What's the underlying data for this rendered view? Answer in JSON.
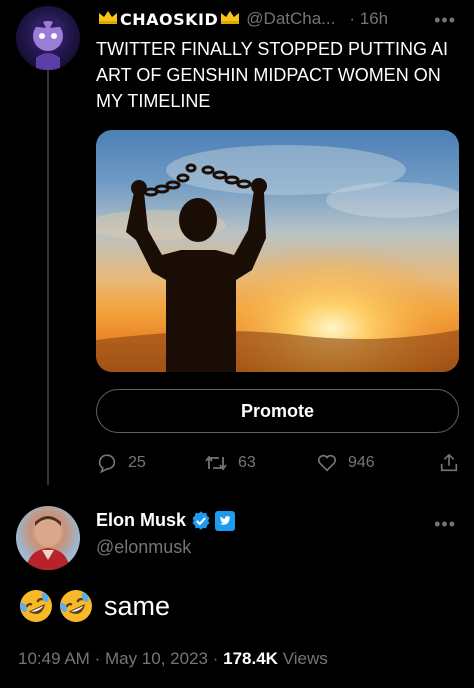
{
  "original_tweet": {
    "display_name": "CHAOSKID",
    "handle": "@DatCha...",
    "separator": "·",
    "time": "16h",
    "more": "•••",
    "text": "TWITTER FINALLY STOPPED PUTTING AI ART OF GENSHIN MIDPACT WOMEN ON MY TIMELINE",
    "promote_label": "Promote",
    "actions": {
      "replies": "25",
      "retweets": "63",
      "likes": "946"
    }
  },
  "reply_tweet": {
    "display_name": "Elon Musk",
    "handle": "@elonmusk",
    "more": "•••",
    "text": "same",
    "time": "10:49 AM",
    "date": "May 10, 2023",
    "separator": "·",
    "views_count": "178.4K",
    "views_label": "Views"
  },
  "colors": {
    "background": "#000000",
    "text_primary": "#e7e9ea",
    "text_secondary": "#71767b",
    "verified_blue": "#1d9bf0",
    "crown_gold": "#f5c518"
  },
  "icons": {
    "reply": "reply-icon",
    "retweet": "retweet-icon",
    "like": "heart-icon",
    "share": "share-icon",
    "verified": "verified-badge-icon",
    "twitter_blue": "twitter-blue-icon",
    "emoji": "rolling-on-floor-laughing-emoji"
  }
}
